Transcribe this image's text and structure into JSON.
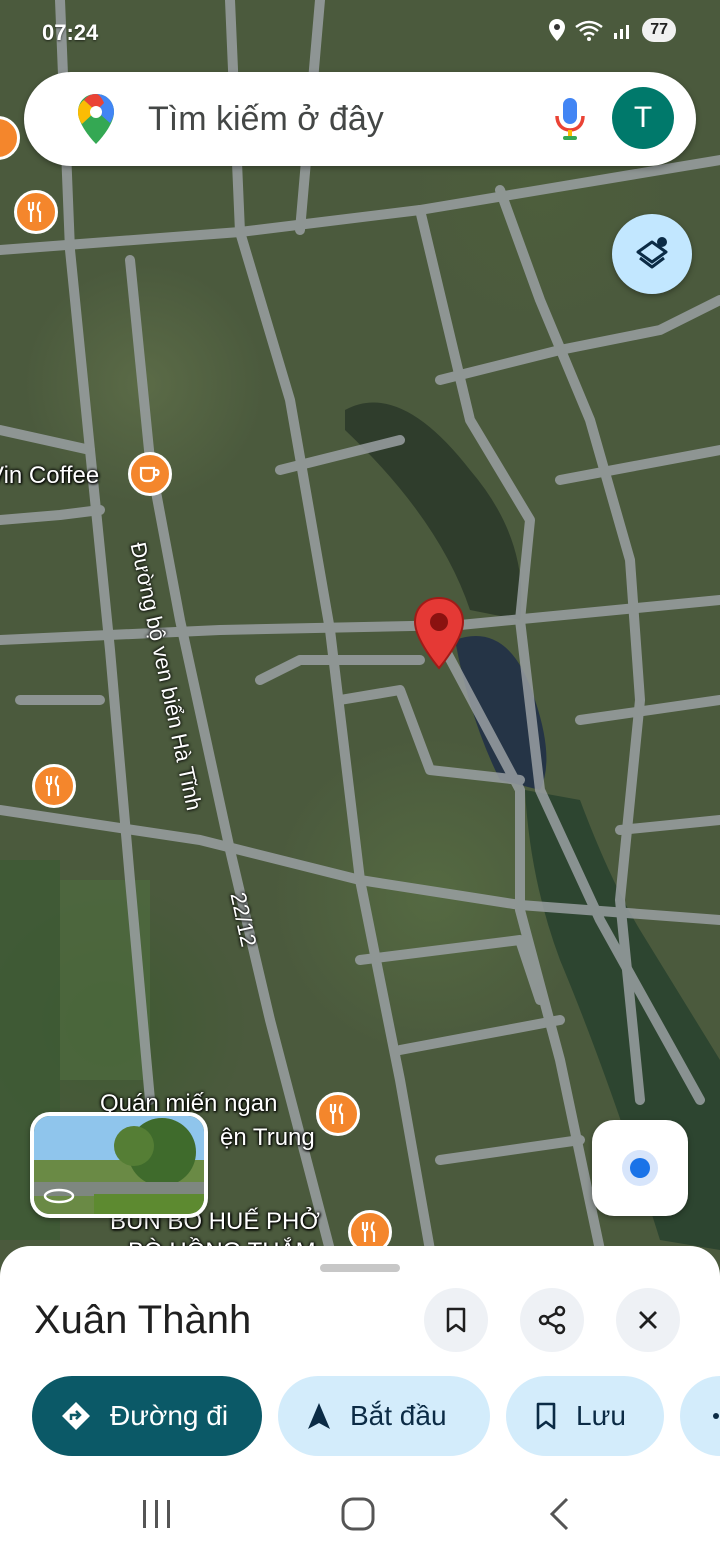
{
  "status_bar": {
    "time": "07:24",
    "battery": "77"
  },
  "search": {
    "placeholder": "Tìm kiếm ở đây",
    "avatar_letter": "T"
  },
  "map_labels": {
    "coffee": "Vin Coffee",
    "road_coastal": "Đường bộ ven biển Hà Tĩnh",
    "road_2212": "22/12",
    "poi_mien_line1": "Quán miến ngan",
    "poi_mien_line2": "ện Trung",
    "poi_bun_line1": "BÚN BÒ HUẾ PHỞ",
    "poi_bun_line2": "BÒ HỒNG THẮM"
  },
  "place": {
    "title": "Xuân Thành"
  },
  "actions": [
    {
      "label": "Đường đi"
    },
    {
      "label": "Bắt đầu"
    },
    {
      "label": "Lưu"
    }
  ],
  "colors": {
    "accent_primary": "#0b5967",
    "chip_bg": "#d3ecfb",
    "poi_orange": "#f4862c",
    "pin_red": "#e53935"
  }
}
